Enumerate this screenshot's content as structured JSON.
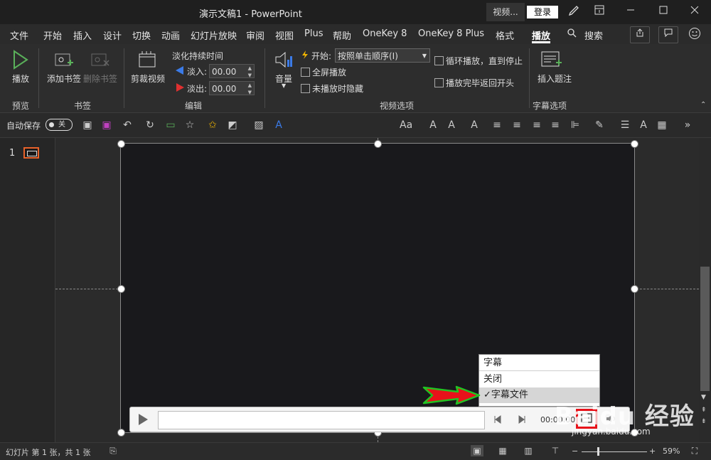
{
  "window": {
    "title": "演示文稿1  -  PowerPoint",
    "video_button": "视频...",
    "login_button": "登录"
  },
  "tabs": [
    {
      "label": "文件"
    },
    {
      "label": "开始"
    },
    {
      "label": "插入"
    },
    {
      "label": "设计"
    },
    {
      "label": "切换"
    },
    {
      "label": "动画"
    },
    {
      "label": "幻灯片放映"
    },
    {
      "label": "审阅"
    },
    {
      "label": "视图"
    },
    {
      "label": "Plus"
    },
    {
      "label": "帮助"
    },
    {
      "label": "OneKey 8"
    },
    {
      "label": "OneKey 8 Plus"
    },
    {
      "label": "格式"
    },
    {
      "label": "播放",
      "active": true
    },
    {
      "label": "搜索"
    }
  ],
  "ribbon": {
    "preview": {
      "play_label": "播放",
      "group": "预览"
    },
    "bookmarks": {
      "add_label": "添加书签",
      "remove_label": "删除书签",
      "group": "书签"
    },
    "edit": {
      "trim_label": "剪裁视频",
      "fade_title": "淡化持续时间",
      "fade_in_label": "淡入:",
      "fade_in_value": "00.00",
      "fade_out_label": "淡出:",
      "fade_out_value": "00.00",
      "group": "编辑"
    },
    "video_options": {
      "volume_label": "音量",
      "start_label": "开始:",
      "start_value": "按照单击顺序(I)",
      "fullscreen_label": "全屏播放",
      "hide_label": "未播放时隐藏",
      "loop_label": "循环播放，直到停止",
      "rewind_label": "播放完毕返回开头",
      "group": "视频选项"
    },
    "captions": {
      "insert_label": "插入题注",
      "group": "字幕选项"
    }
  },
  "qat": {
    "autosave_label": "自动保存",
    "autosave_state": "关"
  },
  "slide_panel": {
    "slide_number": "1"
  },
  "cc_menu": {
    "header": "字幕",
    "off": "关闭",
    "file": "✓字幕文件"
  },
  "video_bar": {
    "time": "00:00.00"
  },
  "status": {
    "slide_info": "幻灯片 第 1 张，共 1 张",
    "zoom": "59%"
  },
  "watermark": {
    "brand": "Baidu 经验",
    "url": "jingyan.baidu.com"
  },
  "colors": {
    "accent_red": "#e8121a",
    "arrow_green": "#22c322"
  }
}
